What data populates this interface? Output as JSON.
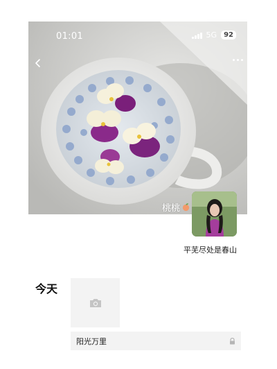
{
  "status_bar": {
    "time": "01:01",
    "network": "5G",
    "battery": "92"
  },
  "profile": {
    "nickname": "桃桃",
    "nickname_emoji_icon": "peach-icon",
    "signature": "平芜尽处是春山"
  },
  "feed": {
    "day_label": "今天",
    "post_text": "阳光万里",
    "privacy_icon": "lock-icon",
    "placeholder_icon": "camera-icon"
  },
  "colors": {
    "background": "#ffffff",
    "feed_card": "#f3f3f3",
    "icon_gray": "#c4c4c4"
  }
}
